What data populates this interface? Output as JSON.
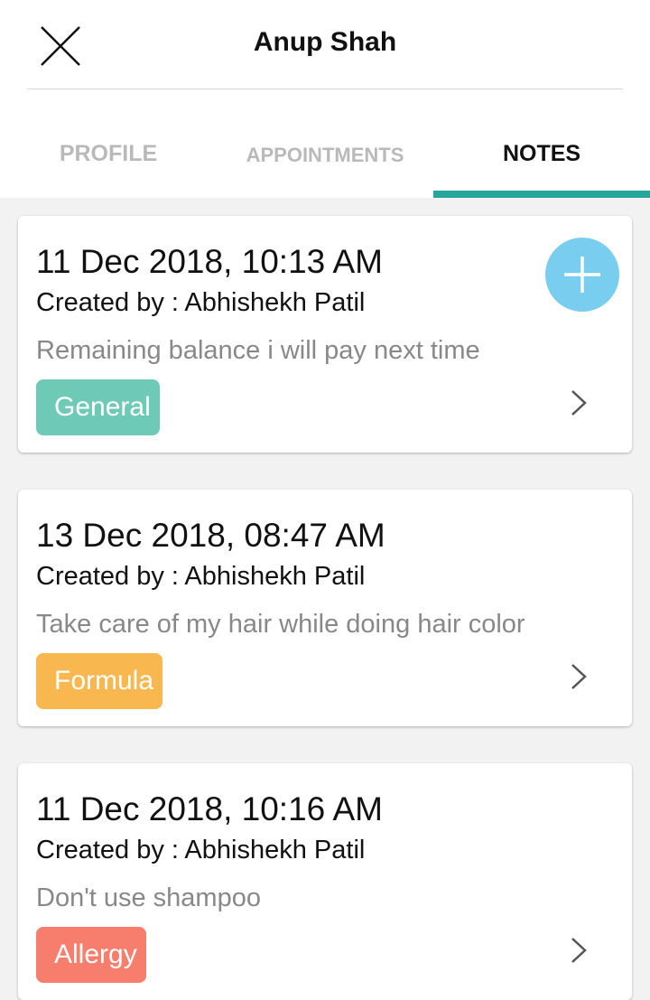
{
  "header": {
    "title": "Anup Shah"
  },
  "tabs": [
    {
      "label": "PROFILE",
      "active": false
    },
    {
      "label": "APPOINTMENTS",
      "active": false
    },
    {
      "label": "NOTES",
      "active": true
    }
  ],
  "accent_color": "#26a69a",
  "fab": {
    "icon": "plus-icon",
    "color": "#79cdee"
  },
  "notes": [
    {
      "date": "11 Dec 2018, 10:13 AM",
      "created_by": "Created by : Abhishekh Patil",
      "text": "Remaining balance i will pay next time",
      "tag": "General",
      "tag_color": "#6ecab6"
    },
    {
      "date": "13 Dec 2018, 08:47 AM",
      "created_by": "Created by : Abhishekh Patil",
      "text": "Take care of my hair while doing hair color",
      "tag": "Formula",
      "tag_color": "#f9b74f"
    },
    {
      "date": "11 Dec 2018, 10:16 AM",
      "created_by": "Created by : Abhishekh Patil",
      "text": "Don't use shampoo",
      "tag": "Allergy",
      "tag_color": "#f77d6c"
    }
  ]
}
